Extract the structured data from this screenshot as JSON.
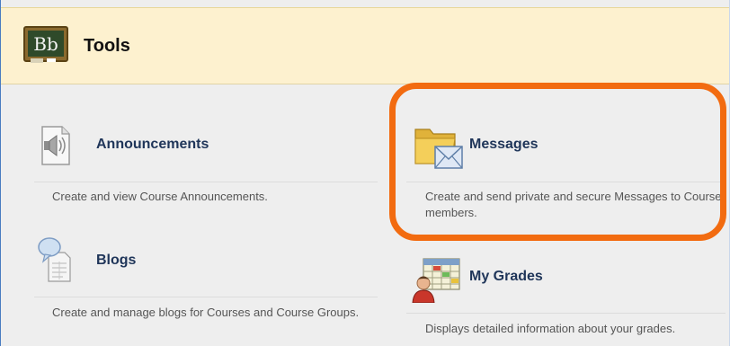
{
  "header": {
    "title": "Tools",
    "logo_text": "Bb"
  },
  "tools": {
    "announcements": {
      "name": "Announcements",
      "description": "Create and view Course Announcements."
    },
    "messages": {
      "name": "Messages",
      "description": "Create and send private and secure Messages to Course members."
    },
    "blogs": {
      "name": "Blogs",
      "description": "Create and manage blogs for Courses and Course Groups."
    },
    "my_grades": {
      "name": "My Grades",
      "description": "Displays detailed information about your grades."
    }
  },
  "colors": {
    "highlight": "#f26b10",
    "header_bg": "#fdf1cf",
    "link": "#1f3559"
  }
}
